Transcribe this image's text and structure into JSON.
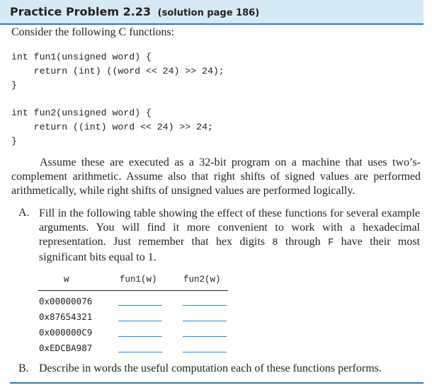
{
  "header": {
    "title": "Practice Problem 2.23",
    "subtitle": "(solution page 186)"
  },
  "intro": "Consider the following C functions:",
  "code": {
    "fun1": [
      "int fun1(unsigned word) {",
      "    return (int) ((word << 24) >> 24);",
      "}"
    ],
    "fun2": [
      "int fun2(unsigned word) {",
      "    return ((int) word << 24) >> 24;",
      "}"
    ]
  },
  "paragraph": "Assume these are executed as a 32-bit program on a machine that uses two’s-complement arithmetic. Assume also that right shifts of signed values are performed arithmetically, while right shifts of unsigned values are performed logically.",
  "part_a": {
    "marker": "A.",
    "text_before_8": "Fill in the following table showing the effect of these functions for several example arguments. You will find it more convenient to work with a hexadecimal representation. Just remember that hex digits ",
    "digit_8": "8",
    "text_through": " through ",
    "digit_F": "F",
    "text_after_F": " have their most significant bits equal to 1."
  },
  "table": {
    "headers": [
      "w",
      "fun1(w)",
      "fun2(w)"
    ],
    "rows": [
      {
        "w": "0x00000076",
        "fun1": "",
        "fun2": ""
      },
      {
        "w": "0x87654321",
        "fun1": "",
        "fun2": ""
      },
      {
        "w": "0x000000C9",
        "fun1": "",
        "fun2": ""
      },
      {
        "w": "0xEDCBA987",
        "fun1": "",
        "fun2": ""
      }
    ]
  },
  "part_b": {
    "marker": "B.",
    "text": "Describe in words the useful computation each of these functions performs."
  },
  "colors": {
    "header_bg": "#d6eaf6",
    "accent_blue": "#1f7fbf",
    "text": "#231f20"
  }
}
